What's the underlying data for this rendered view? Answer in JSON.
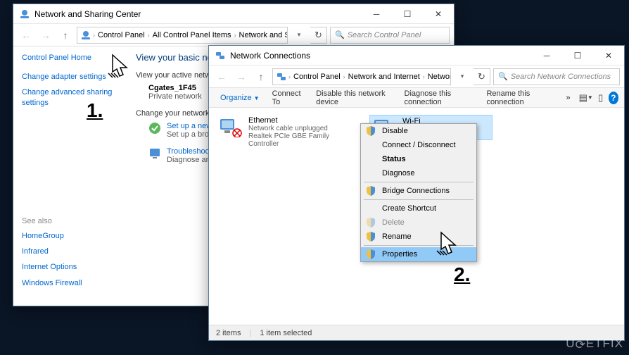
{
  "window1": {
    "title": "Network and Sharing Center",
    "breadcrumb": [
      "Control Panel",
      "All Control Panel Items",
      "Network and Sharing Center"
    ],
    "search_placeholder": "Search Control Panel",
    "sidebar": {
      "home": "Control Panel Home",
      "links": [
        "Change adapter settings",
        "Change advanced sharing settings"
      ],
      "seealso_header": "See also",
      "seealso": [
        "HomeGroup",
        "Infrared",
        "Internet Options",
        "Windows Firewall"
      ]
    },
    "main": {
      "heading": "View your basic network information and set up connections",
      "active_heading": "View your active networks",
      "network_name": "Cgates_1F45",
      "network_type": "Private network",
      "change_heading": "Change your networking settings",
      "actions": [
        {
          "link": "Set up a new connection",
          "desc": "Set up a broadband"
        },
        {
          "link": "Troubleshoot problems",
          "desc": "Diagnose and repair"
        }
      ]
    }
  },
  "window2": {
    "title": "Network Connections",
    "breadcrumb": [
      "Control Panel",
      "Network and Internet",
      "Network Connections"
    ],
    "search_placeholder": "Search Network Connections",
    "toolbar": {
      "organize": "Organize",
      "items": [
        "Connect To",
        "Disable this network device",
        "Diagnose this connection",
        "Rename this connection"
      ]
    },
    "items": [
      {
        "name": "Ethernet",
        "status": "Network cable unplugged",
        "device": "Realtek PCIe GBE Family Controller"
      },
      {
        "name": "Wi-Fi",
        "status": "",
        "device": ""
      }
    ],
    "statusbar": {
      "count": "2 items",
      "selected": "1 item selected"
    }
  },
  "context_menu": {
    "items": [
      {
        "label": "Disable",
        "shield": true
      },
      {
        "label": "Connect / Disconnect"
      },
      {
        "label": "Status",
        "bold": true
      },
      {
        "label": "Diagnose"
      },
      {
        "sep": true
      },
      {
        "label": "Bridge Connections",
        "shield": true
      },
      {
        "sep": true
      },
      {
        "label": "Create Shortcut"
      },
      {
        "label": "Delete",
        "shield": true,
        "disabled": true
      },
      {
        "label": "Rename",
        "shield": true
      },
      {
        "sep": true
      },
      {
        "label": "Properties",
        "shield": true,
        "highlight": true
      }
    ]
  },
  "steps": {
    "one": "1.",
    "two": "2."
  },
  "watermark": "UGETFIX"
}
